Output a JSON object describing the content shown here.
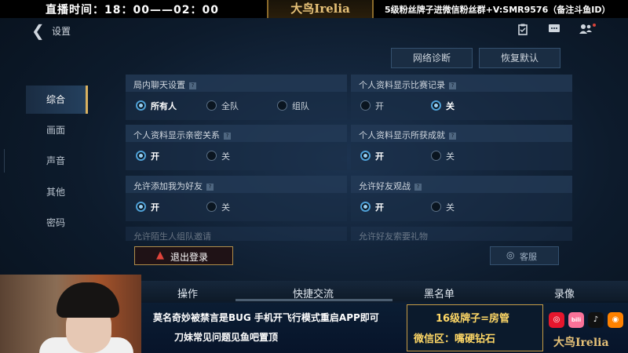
{
  "stream": {
    "live_time": "直播时间：18：00——02：00",
    "logo": "大鸟Irelia",
    "fan_group": "5级粉丝牌子进微信粉丝群+V:SMR9576（备注斗鱼ID）"
  },
  "header": {
    "title": "设置",
    "icons": [
      "clipboard-icon",
      "chat-icon",
      "friends-icon"
    ]
  },
  "actions": {
    "network_diagnosis": "网络诊断",
    "restore_default": "恢复默认"
  },
  "tabs": [
    {
      "label": "综合",
      "active": true
    },
    {
      "label": "画面",
      "active": false
    },
    {
      "label": "声音",
      "active": false
    },
    {
      "label": "其他",
      "active": false
    },
    {
      "label": "密码",
      "active": false
    }
  ],
  "settings": [
    {
      "title": "局内聊天设置",
      "options": [
        "所有人",
        "全队",
        "组队"
      ],
      "selected": 0
    },
    {
      "title": "个人资料显示比赛记录",
      "options": [
        "开",
        "关"
      ],
      "selected": 1
    },
    {
      "title": "个人资料显示亲密关系",
      "options": [
        "开",
        "关"
      ],
      "selected": 0
    },
    {
      "title": "个人资料显示所获成就",
      "options": [
        "开",
        "关"
      ],
      "selected": 0
    },
    {
      "title": "允许添加我为好友",
      "options": [
        "开",
        "关"
      ],
      "selected": 0
    },
    {
      "title": "允许好友观战",
      "options": [
        "开",
        "关"
      ],
      "selected": 0
    },
    {
      "title": "允许陌生人组队邀请"
    },
    {
      "title": "允许好友索要礼物"
    }
  ],
  "logout_label": "退出登录",
  "service_label": "客服",
  "bottom_tabs": [
    "操作",
    "快捷交流",
    "黑名单",
    "录像"
  ],
  "overlay": {
    "line1": "莫名奇妙被禁言是BUG 手机开飞行模式重启APP即可",
    "line2": "刀妹常见问题见鱼吧置顶",
    "fan_line1": "16级牌子=房管",
    "fan_line2": "微信区：嘴硬钻石",
    "social": [
      {
        "name": "weibo-icon",
        "color": "#e6162d"
      },
      {
        "name": "bilibili-icon",
        "color": "#fb7299"
      },
      {
        "name": "douyin-icon",
        "color": "#111111"
      },
      {
        "name": "weibo-alt-icon",
        "color": "#ff8200"
      }
    ],
    "logo": "大鸟Irelia"
  }
}
